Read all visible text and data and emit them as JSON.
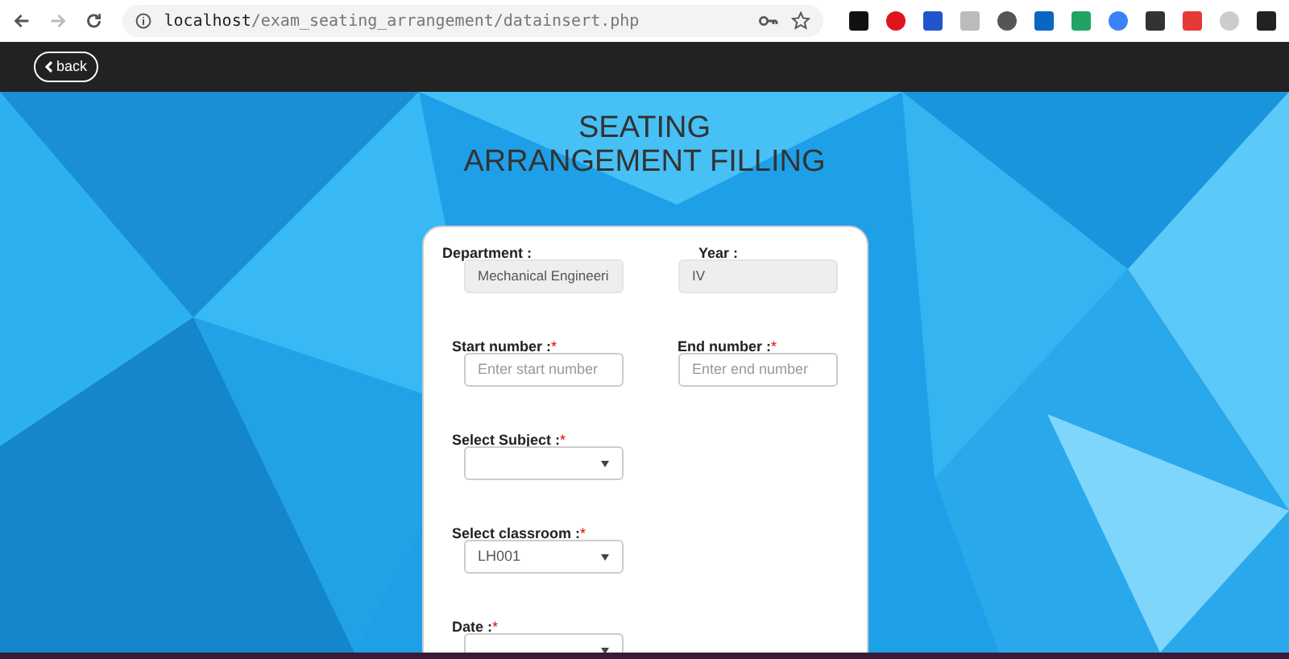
{
  "browser": {
    "url_host": "localhost",
    "url_path": "/exam_seating_arrangement/datainsert.php",
    "extensions": [
      {
        "color": "#111111"
      },
      {
        "color": "#e0141e"
      },
      {
        "color": "#2255cc"
      },
      {
        "color": "#bbbbbb"
      },
      {
        "color": "#555555"
      },
      {
        "color": "#0a66c2"
      },
      {
        "color": "#1fa463"
      },
      {
        "color": "#3b82f6"
      },
      {
        "color": "#333333"
      },
      {
        "color": "#e53935"
      },
      {
        "color": "#cccccc"
      },
      {
        "color": "#222222"
      }
    ]
  },
  "navbar": {
    "back_button": "back"
  },
  "heading": [
    "SEATING",
    "ARRANGEMENT FILLING"
  ],
  "form": {
    "rows": [
      [
        {
          "label": "Department :",
          "kind": "readonly",
          "value": "Mechanical Engineeri"
        },
        {
          "label": "Year :",
          "kind": "readonly",
          "value": "IV"
        }
      ],
      [
        {
          "label": "Start number :",
          "mark": "*",
          "kind": "text",
          "placeholder": "Enter start number"
        },
        {
          "label": "End number :",
          "mark": "*",
          "kind": "text",
          "placeholder": "Enter end number"
        }
      ],
      [
        {
          "label": "Select Subject :",
          "mark": "*",
          "kind": "select"
        }
      ],
      [
        {
          "label": "Select classroom :",
          "mark": "*",
          "kind": "select",
          "value": "LH001"
        }
      ],
      [
        {
          "label": "Date :",
          "mark": "*",
          "kind": "select"
        }
      ]
    ]
  }
}
